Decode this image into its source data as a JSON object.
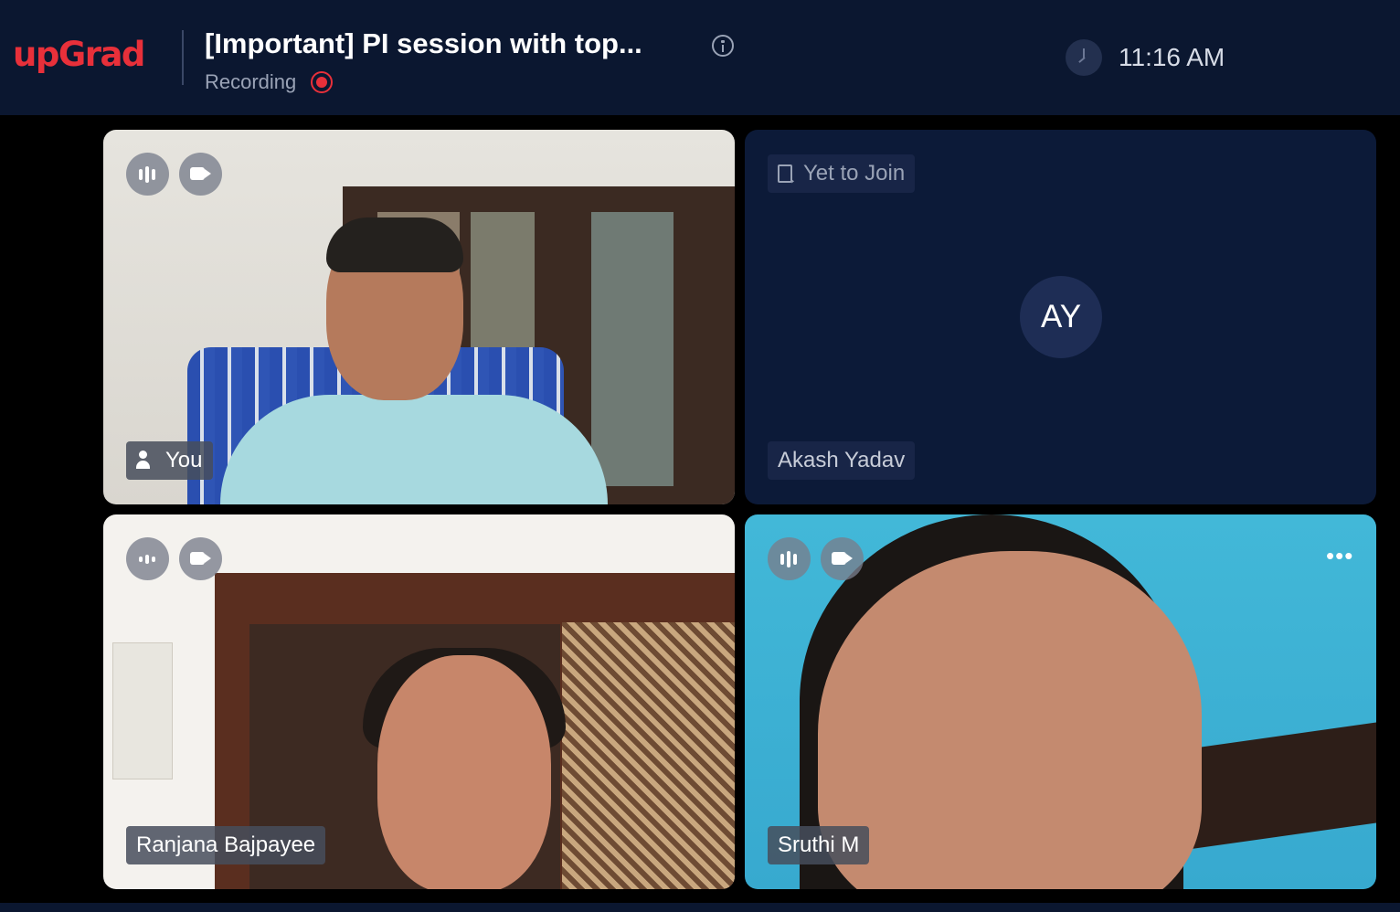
{
  "app": {
    "logo_text": "upGrad",
    "brand_color": "#e8303a"
  },
  "header": {
    "title": "[Important] PI session with top...",
    "recording_label": "Recording",
    "time": "11:16 AM",
    "icons": [
      "info-icon",
      "recording-dot-icon",
      "clock-icon"
    ]
  },
  "participants": [
    {
      "name": "You",
      "status": "video",
      "icons": [
        "mic-bars-icon",
        "camera-icon",
        "speaker-icon"
      ]
    },
    {
      "name": "Akash Yadav",
      "status": "Yet to Join",
      "initials": "AY",
      "icons": [
        "exit-icon"
      ]
    },
    {
      "name": "Ranjana Bajpayee",
      "status": "video",
      "icons": [
        "mic-bars-icon",
        "camera-icon"
      ]
    },
    {
      "name": "Sruthi M",
      "status": "video",
      "icons": [
        "mic-bars-icon",
        "camera-icon",
        "more-options-icon"
      ]
    }
  ]
}
